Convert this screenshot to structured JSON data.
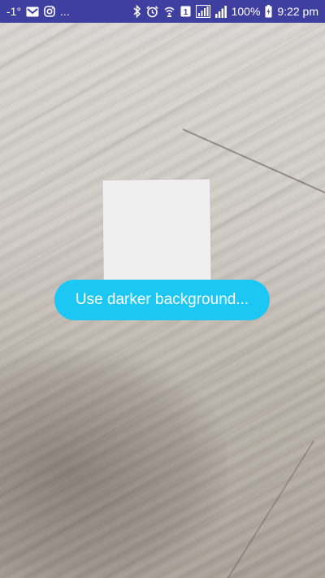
{
  "status_bar": {
    "temperature": "-1°",
    "more": "...",
    "battery_percent": "100%",
    "time": "9:22 pm",
    "sim_badge": "1",
    "icons": [
      "gmail-icon",
      "instagram-icon",
      "bluetooth-icon",
      "alarm-icon",
      "wifi-calling-icon",
      "signal-icon",
      "signal-bars-icon",
      "battery-charging-icon"
    ],
    "background_color": "#3f3fa0"
  },
  "toast": {
    "message": "Use darker background...",
    "background_color": "#1cc7f4"
  }
}
